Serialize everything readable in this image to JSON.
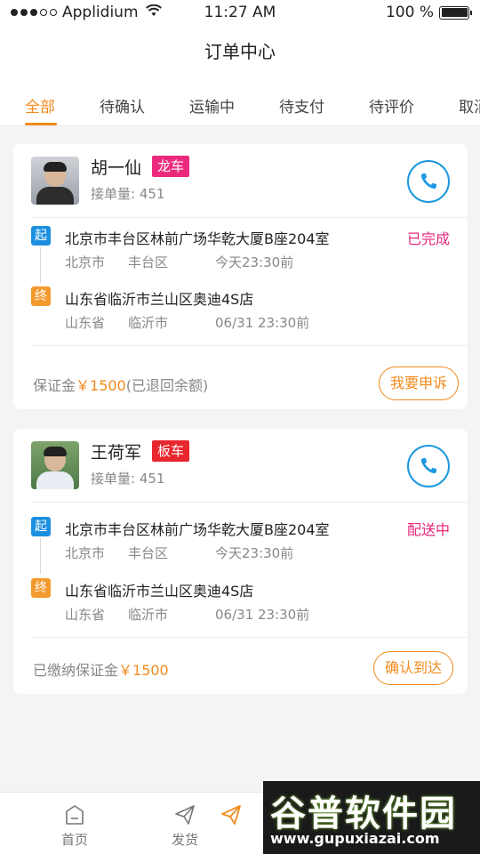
{
  "status_bar": {
    "carrier": "Applidium",
    "time": "11:27 AM",
    "battery": "100 %",
    "signal_dots_filled": 3,
    "signal_dots_total": 5
  },
  "header": {
    "title": "订单中心"
  },
  "tabs": [
    {
      "label": "全部",
      "active": true
    },
    {
      "label": "待确认",
      "active": false
    },
    {
      "label": "运输中",
      "active": false
    },
    {
      "label": "待支付",
      "active": false
    },
    {
      "label": "待评价",
      "active": false
    },
    {
      "label": "取消",
      "active": false
    }
  ],
  "orders": [
    {
      "driver_name": "胡一仙",
      "vehicle_tag": "龙车",
      "orders_label": "接单量:",
      "orders_count": "451",
      "from_badge": "起",
      "from_address": "北京市丰台区林前广场华乾大厦B座204室",
      "from_province": "北京市",
      "from_district": "丰台区",
      "from_time": "今天23:30前",
      "to_badge": "终",
      "to_address": "山东省临沂市兰山区奥迪4S店",
      "to_province": "山东省",
      "to_city": "临沂市",
      "to_time": "06/31  23:30前",
      "status": "已完成",
      "deposit_prefix": "保证金",
      "deposit_amount": "￥1500",
      "deposit_suffix": "(已退回余额)",
      "action_label": "我要申诉"
    },
    {
      "driver_name": "王荷军",
      "vehicle_tag": "板车",
      "orders_label": "接单量:",
      "orders_count": "451",
      "from_badge": "起",
      "from_address": "北京市丰台区林前广场华乾大厦B座204室",
      "from_province": "北京市",
      "from_district": "丰台区",
      "from_time": "今天23:30前",
      "to_badge": "终",
      "to_address": "山东省临沂市兰山区奥迪4S店",
      "to_province": "山东省",
      "to_city": "临沂市",
      "to_time": "06/31  23:30前",
      "status": "配送中",
      "deposit_prefix": "已缴纳保证金",
      "deposit_amount": "￥1500",
      "deposit_suffix": "",
      "action_label": "确认到达"
    }
  ],
  "bottom_nav": [
    {
      "label": "首页",
      "icon": "home-icon"
    },
    {
      "label": "发货",
      "icon": "send-icon"
    },
    {
      "label": "",
      "icon": "send-active-icon"
    }
  ],
  "watermark": {
    "title": "谷普软件园",
    "url": "www.gupuxiazai.com"
  },
  "colors": {
    "accent": "#f28a1e",
    "phone_blue": "#1d98e0",
    "status_pink": "#e8267a",
    "tag_pink": "#ec2a7d",
    "tag_red": "#e8262e"
  }
}
